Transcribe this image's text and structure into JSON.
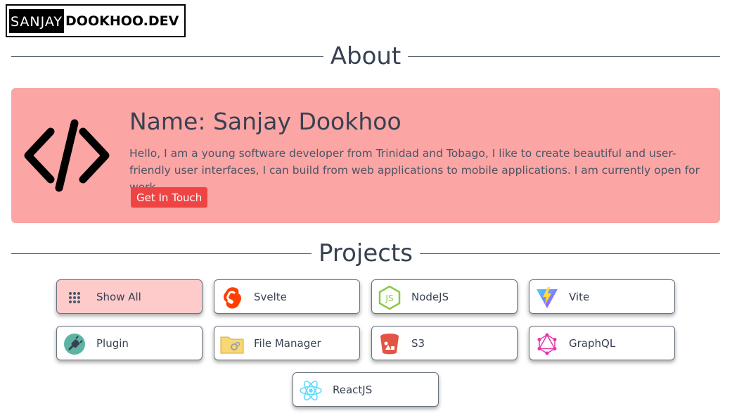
{
  "logo": {
    "first": "SANJAY",
    "second": "DOOKHOO.DEV"
  },
  "about": {
    "title": "About",
    "name": "Name: Sanjay Dookhoo",
    "description": "Hello, I am a young software developer from Trinidad and Tobago, I like to create beautiful and user-friendly user interfaces, I can build from web applications to mobile applications. I am currently open for work",
    "button_label": "Get In Touch",
    "icon": "code-icon"
  },
  "projects": {
    "title": "Projects",
    "filters": [
      {
        "label": "Show All",
        "icon": "grid-icon",
        "active": true
      },
      {
        "label": "Svelte",
        "icon": "svelte-icon"
      },
      {
        "label": "NodeJS",
        "icon": "nodejs-icon"
      },
      {
        "label": "Vite",
        "icon": "vite-icon"
      },
      {
        "label": "Plugin",
        "icon": "plugin-icon"
      },
      {
        "label": "File Manager",
        "icon": "folder-icon"
      },
      {
        "label": "S3",
        "icon": "s3-bucket-icon"
      },
      {
        "label": "GraphQL",
        "icon": "graphql-icon"
      },
      {
        "label": "ReactJS",
        "icon": "react-icon"
      }
    ]
  },
  "colors": {
    "card_bg": "#fca5a5",
    "button_bg": "#ef4444",
    "active_filter_bg": "#fecaca"
  }
}
